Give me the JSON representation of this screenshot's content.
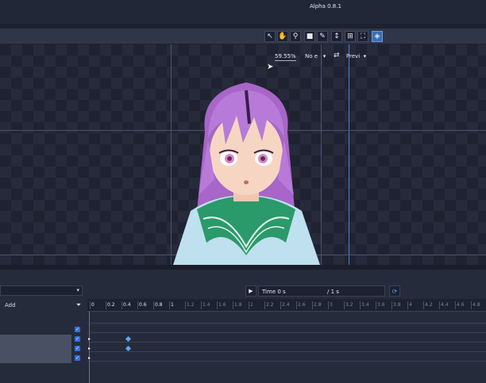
{
  "app": {
    "title": "Alpha 0.8.1"
  },
  "toolbar": {
    "tools": [
      {
        "id": "select",
        "glyph": "↖",
        "active": false
      },
      {
        "id": "pan",
        "glyph": "✋",
        "active": false
      },
      {
        "id": "bone",
        "glyph": "⚲",
        "active": false
      },
      {
        "id": "rect",
        "glyph": "■",
        "active": false
      },
      {
        "id": "pen",
        "glyph": "✎",
        "active": false
      },
      {
        "id": "scale-vertical",
        "glyph": "↕",
        "active": false
      },
      {
        "id": "transform",
        "glyph": "⊞",
        "active": false
      },
      {
        "id": "crop",
        "glyph": "⛶",
        "active": false
      },
      {
        "id": "layers",
        "glyph": "◈",
        "active": true
      }
    ]
  },
  "viewport": {
    "zoom": "59.55%",
    "mode": "No e",
    "preview": "Previ"
  },
  "timeline": {
    "time_label": "Time",
    "time_value": "0 s",
    "time_total": "/ 1 s",
    "add_label": "Add",
    "ruler_ticks": [
      "0",
      "0.2",
      "0.4",
      "0.6",
      "0.8",
      "1",
      "1.2",
      "1.4",
      "1.6",
      "1.8",
      "2",
      "2.2",
      "2.4",
      "2.6",
      "2.8",
      "3",
      "3.2",
      "3.4",
      "3.6",
      "3.8",
      "4",
      "4.2",
      "4.4",
      "4.6",
      "4.8"
    ],
    "major_ticks": [
      "0",
      "0.2",
      "0.4",
      "0.6",
      "0.8",
      "1"
    ]
  },
  "colors": {
    "accent": "#3a6fb0",
    "keyframe": "#5aa8ff",
    "hair": "#b87ad8",
    "uniform_collar": "#2a9a6a",
    "uniform": "#bfe0ee"
  }
}
